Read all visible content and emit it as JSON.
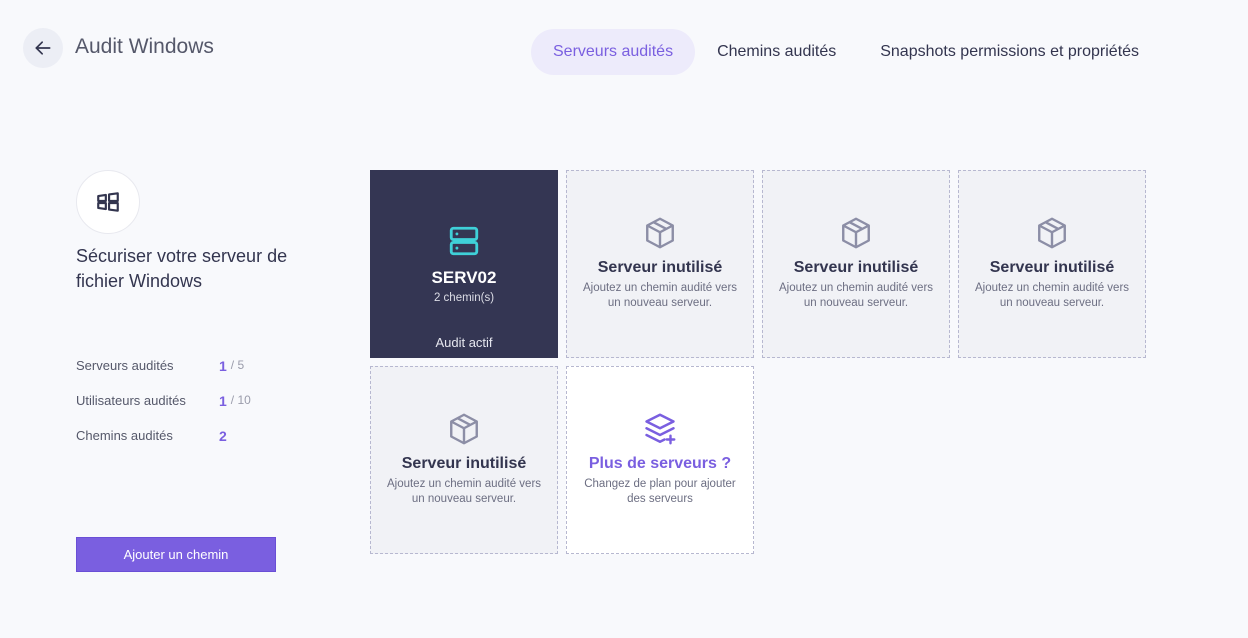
{
  "header": {
    "title": "Audit Windows",
    "back_icon": "arrow-left-icon"
  },
  "tabs": [
    {
      "label": "Serveurs audités",
      "active": true
    },
    {
      "label": "Chemins audités",
      "active": false
    },
    {
      "label": "Snapshots permissions et propriétés",
      "active": false
    }
  ],
  "panel": {
    "icon": "windows-icon",
    "title": "Sécuriser votre serveur de fichier Windows",
    "stats": [
      {
        "label": "Serveurs audités",
        "value": "1",
        "total": "/ 5"
      },
      {
        "label": "Utilisateurs audités",
        "value": "1",
        "total": "/ 10"
      },
      {
        "label": "Chemins audités",
        "value": "2",
        "total": ""
      }
    ],
    "add_button": "Ajouter un chemin"
  },
  "servers": {
    "active": {
      "name": "SERV02",
      "paths": "2 chemin(s)",
      "status": "Audit actif",
      "icon": "server-icon"
    },
    "unused": {
      "name": "Serveur inutilisé",
      "desc": "Ajoutez un chemin audité vers un nouveau serveur.",
      "icon": "box-icon"
    },
    "upsell": {
      "name": "Plus de serveurs ?",
      "desc": "Changez de plan pour ajouter des serveurs",
      "icon": "layers-plus-icon"
    }
  },
  "colors": {
    "accent": "#7a5fe0",
    "active_card": "#343653",
    "server_icon": "#3fd0d8"
  }
}
